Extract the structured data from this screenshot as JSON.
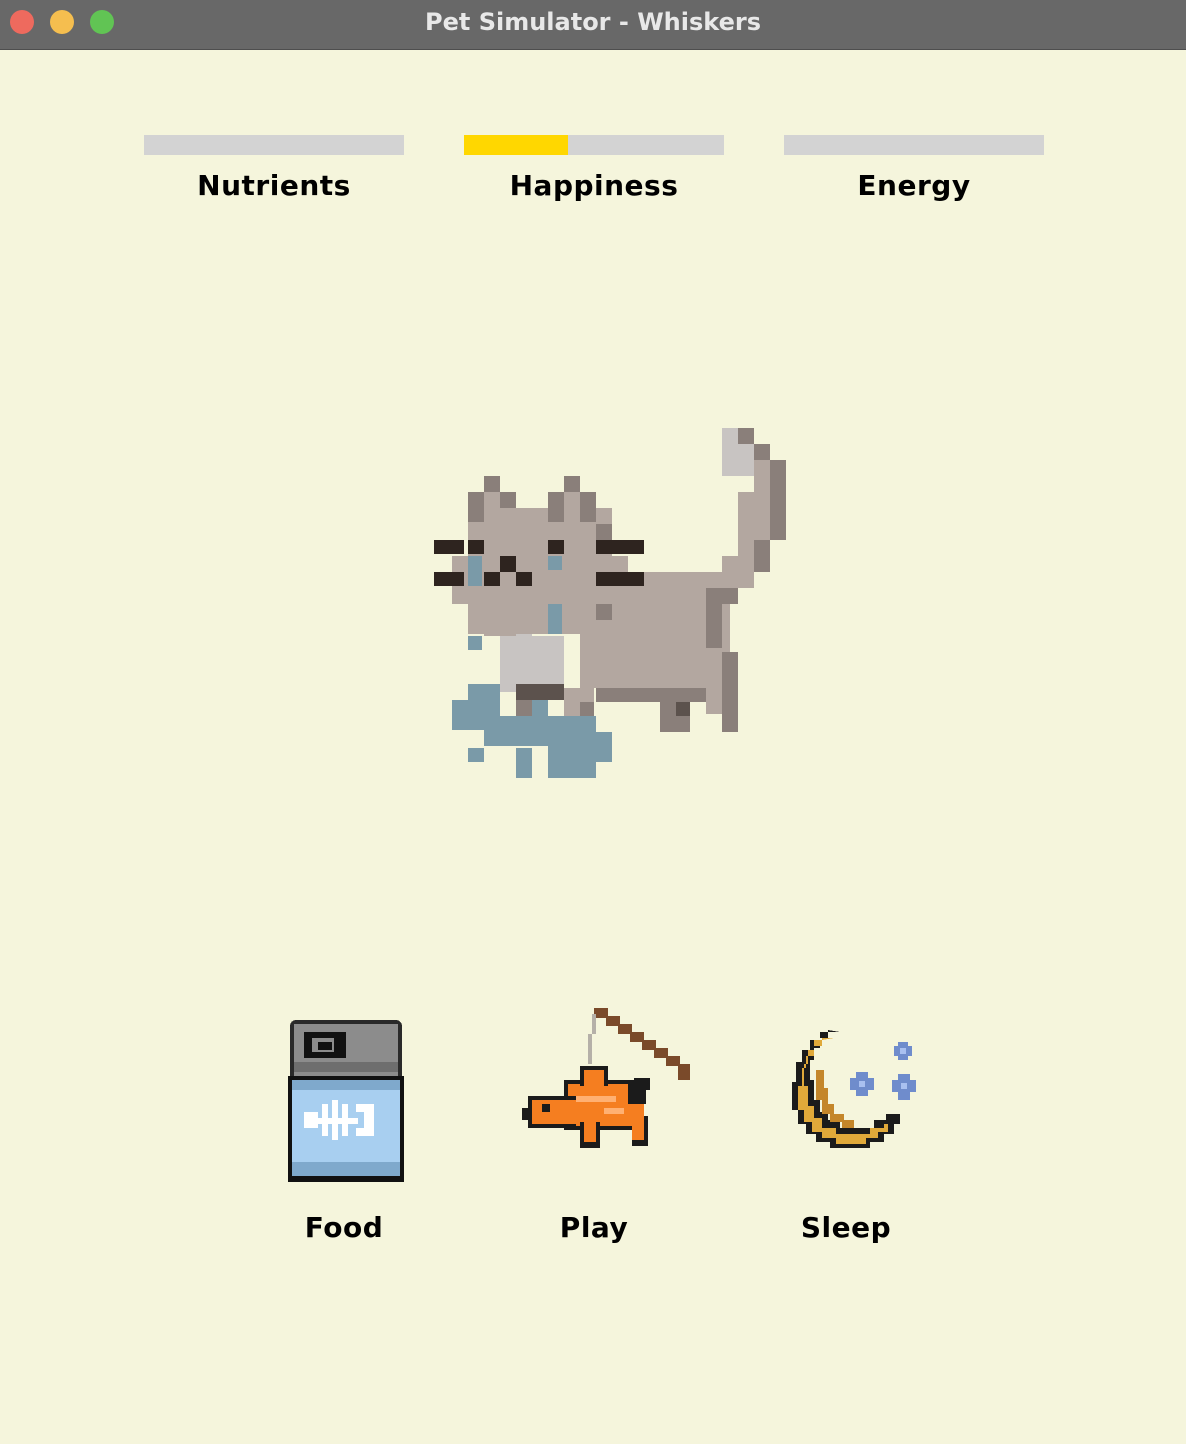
{
  "window": {
    "title": "Pet Simulator - Whiskers"
  },
  "stats": [
    {
      "name": "Nutrients",
      "value": 0.0,
      "color": "#d3d3d3"
    },
    {
      "name": "Happiness",
      "value": 0.4,
      "color": "#ffd700"
    },
    {
      "name": "Energy",
      "value": 0.0,
      "color": "#d3d3d3"
    }
  ],
  "pet": {
    "icon": "crying-cat-sprite"
  },
  "actions": [
    {
      "label": "Food",
      "icon": "cat-food-can-icon"
    },
    {
      "label": "Play",
      "icon": "fish-toy-icon"
    },
    {
      "label": "Sleep",
      "icon": "crescent-moon-icon"
    }
  ],
  "colors": {
    "background": "#f5f5dc",
    "titlebar": "#686868",
    "bar_track": "#d3d3d3",
    "happiness_fill": "#ffd700"
  }
}
